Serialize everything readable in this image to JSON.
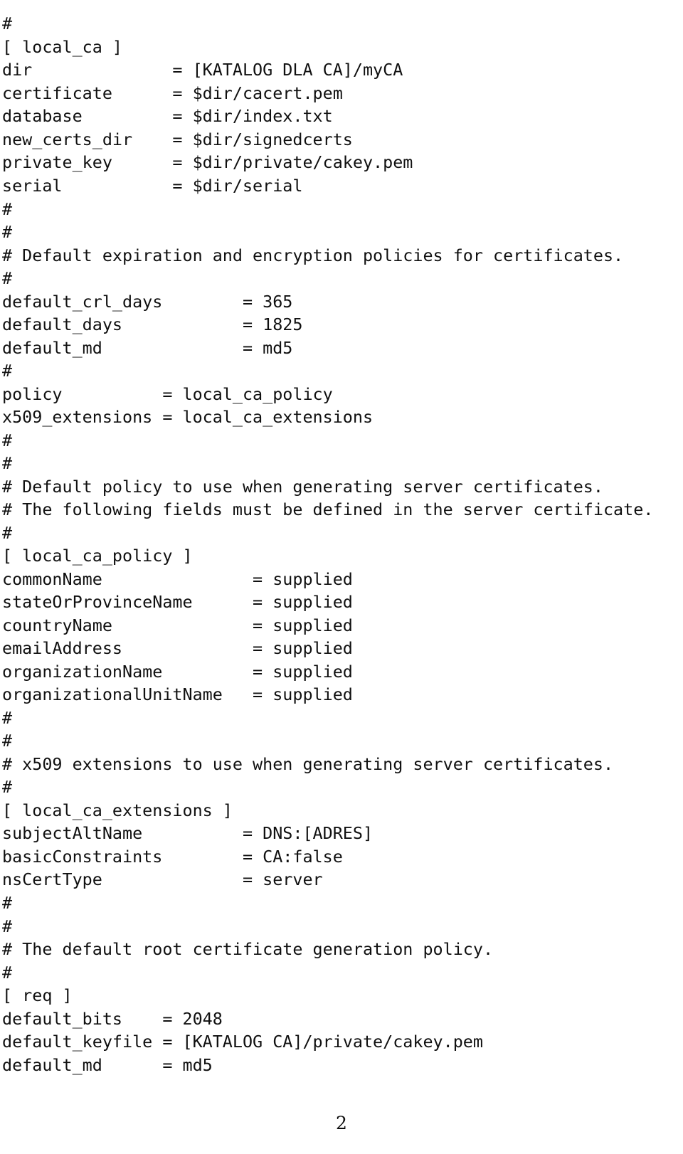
{
  "document": {
    "kind": "configuration-file-listing",
    "page_number": "2",
    "text_color": "#101010",
    "background_color": "#ffffff",
    "lines": [
      "#",
      "[ local_ca ]",
      "dir              = [KATALOG DLA CA]/myCA",
      "certificate      = $dir/cacert.pem",
      "database         = $dir/index.txt",
      "new_certs_dir    = $dir/signedcerts",
      "private_key      = $dir/private/cakey.pem",
      "serial           = $dir/serial",
      "#",
      "#",
      "# Default expiration and encryption policies for certificates.",
      "#",
      "default_crl_days        = 365",
      "default_days            = 1825",
      "default_md              = md5",
      "#",
      "policy          = local_ca_policy",
      "x509_extensions = local_ca_extensions",
      "#",
      "#",
      "# Default policy to use when generating server certificates.",
      "# The following fields must be defined in the server certificate.",
      "#",
      "[ local_ca_policy ]",
      "commonName               = supplied",
      "stateOrProvinceName      = supplied",
      "countryName              = supplied",
      "emailAddress             = supplied",
      "organizationName         = supplied",
      "organizationalUnitName   = supplied",
      "#",
      "#",
      "# x509 extensions to use when generating server certificates.",
      "#",
      "[ local_ca_extensions ]",
      "subjectAltName          = DNS:[ADRES]",
      "basicConstraints        = CA:false",
      "nsCertType              = server",
      "#",
      "#",
      "# The default root certificate generation policy.",
      "#",
      "[ req ]",
      "default_bits    = 2048",
      "default_keyfile = [KATALOG CA]/private/cakey.pem",
      "default_md      = md5"
    ],
    "sections": [
      {
        "name": "[ local_ca ]",
        "entries": [
          {
            "key": "dir",
            "value": "[KATALOG DLA CA]/myCA"
          },
          {
            "key": "certificate",
            "value": "$dir/cacert.pem"
          },
          {
            "key": "database",
            "value": "$dir/index.txt"
          },
          {
            "key": "new_certs_dir",
            "value": "$dir/signedcerts"
          },
          {
            "key": "private_key",
            "value": "$dir/private/cakey.pem"
          },
          {
            "key": "serial",
            "value": "$dir/serial"
          },
          {
            "key": "default_crl_days",
            "value": "365"
          },
          {
            "key": "default_days",
            "value": "1825"
          },
          {
            "key": "default_md",
            "value": "md5"
          },
          {
            "key": "policy",
            "value": "local_ca_policy"
          },
          {
            "key": "x509_extensions",
            "value": "local_ca_extensions"
          }
        ]
      },
      {
        "name": "[ local_ca_policy ]",
        "entries": [
          {
            "key": "commonName",
            "value": "supplied"
          },
          {
            "key": "stateOrProvinceName",
            "value": "supplied"
          },
          {
            "key": "countryName",
            "value": "supplied"
          },
          {
            "key": "emailAddress",
            "value": "supplied"
          },
          {
            "key": "organizationName",
            "value": "supplied"
          },
          {
            "key": "organizationalUnitName",
            "value": "supplied"
          }
        ]
      },
      {
        "name": "[ local_ca_extensions ]",
        "entries": [
          {
            "key": "subjectAltName",
            "value": "DNS:[ADRES]"
          },
          {
            "key": "basicConstraints",
            "value": "CA:false"
          },
          {
            "key": "nsCertType",
            "value": "server"
          }
        ]
      },
      {
        "name": "[ req ]",
        "entries": [
          {
            "key": "default_bits",
            "value": "2048"
          },
          {
            "key": "default_keyfile",
            "value": "[KATALOG CA]/private/cakey.pem"
          },
          {
            "key": "default_md",
            "value": "md5"
          }
        ]
      }
    ],
    "comments": [
      "# Default expiration and encryption policies for certificates.",
      "# Default policy to use when generating server certificates.",
      "# The following fields must be defined in the server certificate.",
      "# x509 extensions to use when generating server certificates.",
      "# The default root certificate generation policy."
    ]
  }
}
